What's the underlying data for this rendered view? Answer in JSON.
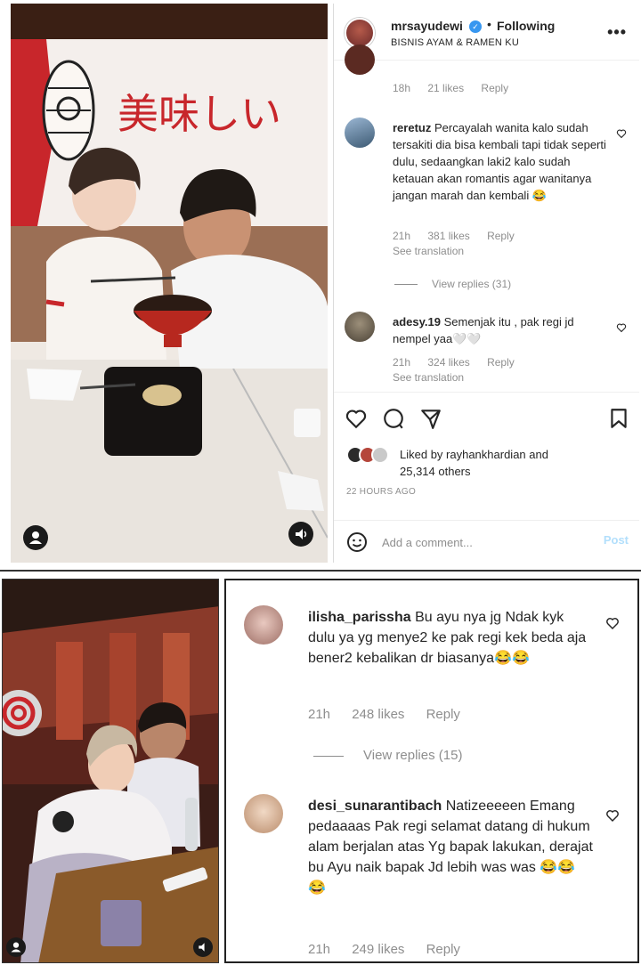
{
  "post": {
    "username": "mrsayudewi",
    "separator": "•",
    "follow_status": "Following",
    "subtitle": "BISNIS AYAM & RAMEN KU",
    "video_sign_text": "美味しい"
  },
  "comments": [
    {
      "username": "",
      "text": "",
      "time": "18h",
      "likes": "21 likes",
      "reply": "Reply"
    },
    {
      "username": "reretuz",
      "text": "Percayalah wanita kalo sudah tersakiti dia bisa kembali tapi tidak seperti dulu, sedaangkan laki2 kalo sudah ketauan akan romantis agar wanitanya jangan marah dan kembali 😂",
      "time": "21h",
      "likes": "381 likes",
      "reply": "Reply",
      "translation": "See translation"
    },
    {
      "username": "adesy.19",
      "text": "Semenjak itu , pak regi jd nempel yaa🤍🤍",
      "time": "21h",
      "likes": "324 likes",
      "reply": "Reply",
      "translation": "See translation"
    }
  ],
  "view_replies": "View replies (31)",
  "liked_by": {
    "line1": "Liked by rayhankhardian and",
    "line2": "25,314 others"
  },
  "timestamp": "22 HOURS AGO",
  "add_comment": {
    "placeholder": "Add a comment...",
    "post_label": "Post"
  },
  "bottom_comments": [
    {
      "username": "ilisha_parissha",
      "text": "Bu ayu nya jg Ndak kyk dulu ya yg menye2 ke pak regi kek beda aja bener2 kebalikan dr biasanya😂😂",
      "time": "21h",
      "likes": "248 likes",
      "reply": "Reply"
    },
    {
      "username": "desi_sunarantibach",
      "text": "Natizeeeeen Emang pedaaaas Pak regi selamat datang di hukum alam berjalan atas Yg bapak lakukan, derajat bu Ayu naik bapak Jd lebih was was 😂😂😂",
      "time": "21h",
      "likes": "249 likes",
      "reply": "Reply"
    }
  ],
  "bottom_view_replies": "View replies (15)",
  "colors": {
    "verified": "#3897f0",
    "muted": "#8e8e8e",
    "post_disabled": "#b2dffc",
    "text": "#262626"
  },
  "icons": [
    "verified-icon",
    "more-icon",
    "heart-icon",
    "comment-icon",
    "share-icon",
    "bookmark-icon",
    "smile-icon",
    "user-icon",
    "sound-icon"
  ]
}
